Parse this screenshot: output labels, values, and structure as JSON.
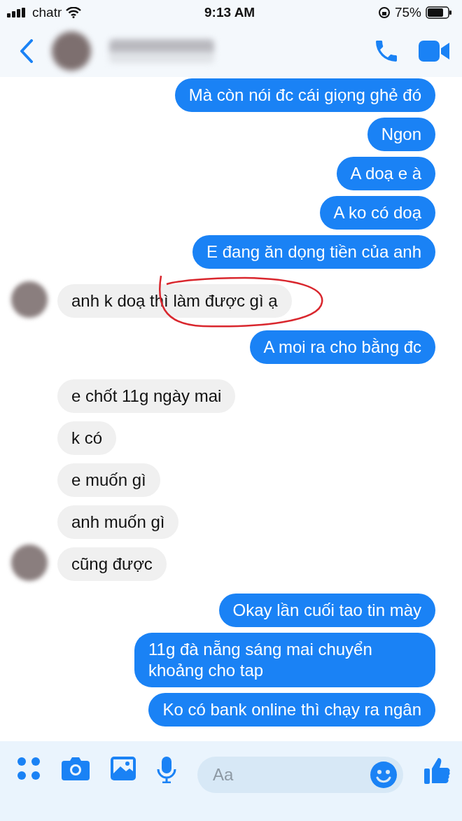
{
  "status_bar": {
    "carrier": "chatr",
    "time": "9:13 AM",
    "battery": "75%"
  },
  "groups": [
    {
      "kind": "sent",
      "messages": [
        {
          "text": "Mà còn nói đc cái giọng ghẻ đó",
          "annotated": false
        },
        {
          "text": "Ngon",
          "annotated": false
        },
        {
          "text": "A doạ e à",
          "annotated": false
        },
        {
          "text": "A ko có doạ",
          "annotated": false
        },
        {
          "text": "E đang ăn dọng tiền của anh",
          "annotated": false
        }
      ]
    },
    {
      "kind": "received",
      "messages": [
        {
          "text": "anh k doạ thì làm được gì ạ",
          "annotated": true
        }
      ]
    },
    {
      "kind": "sent",
      "messages": [
        {
          "text": "A moi ra cho bằng đc",
          "annotated": false
        }
      ]
    },
    {
      "kind": "received",
      "messages": [
        {
          "text": "e chốt 11g ngày mai",
          "annotated": false
        },
        {
          "text": "k có",
          "annotated": false
        },
        {
          "text": "e muốn gì",
          "annotated": false
        },
        {
          "text": "anh muốn gì",
          "annotated": false
        },
        {
          "text": "cũng được",
          "annotated": false
        }
      ]
    },
    {
      "kind": "sent",
      "messages": [
        {
          "text": "Okay lần cuối tao tin mày",
          "annotated": false
        },
        {
          "text": "11g đà nẵng sáng mai chuyển khoảng cho tap",
          "annotated": false
        },
        {
          "text": "Ko có bank online thì chạy ra ngân",
          "annotated": false
        }
      ]
    }
  ],
  "composer": {
    "placeholder": "Aa"
  }
}
